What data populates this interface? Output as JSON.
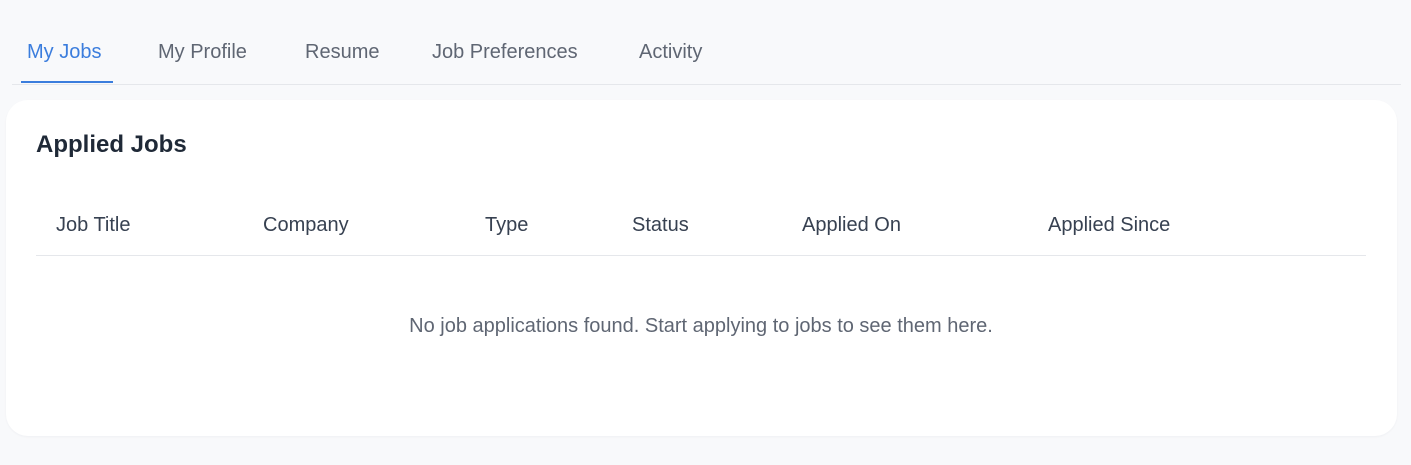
{
  "tabs": [
    {
      "label": "My Jobs",
      "active": true
    },
    {
      "label": "My Profile",
      "active": false
    },
    {
      "label": "Resume",
      "active": false
    },
    {
      "label": "Job Preferences",
      "active": false
    },
    {
      "label": "Activity",
      "active": false
    }
  ],
  "applied_jobs": {
    "title": "Applied Jobs",
    "columns": [
      "Job Title",
      "Company",
      "Type",
      "Status",
      "Applied On",
      "Applied Since"
    ],
    "rows": [],
    "empty_message": "No job applications found. Start applying to jobs to see them here."
  },
  "colors": {
    "accent": "#3b7ddd",
    "page_background": "#f8f9fb",
    "card_background": "#ffffff"
  }
}
